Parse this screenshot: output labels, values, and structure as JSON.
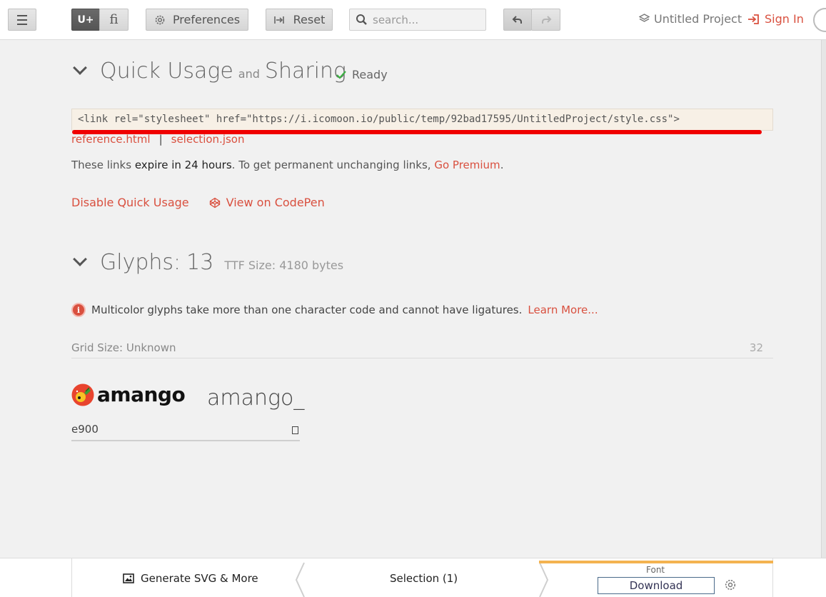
{
  "topbar": {
    "uplus_label": "U+",
    "fi_label": "fi",
    "preferences_label": "Preferences",
    "reset_label": "Reset",
    "search_placeholder": "search...",
    "project_name": "Untitled Project",
    "signin_label": "Sign In"
  },
  "quick_usage": {
    "title_part1": "Quick Usage",
    "title_and": "and",
    "title_part2": "Sharing",
    "status": "Ready",
    "code": "<link rel=\"stylesheet\" href=\"https://i.icomoon.io/public/temp/92bad17595/UntitledProject/style.css\">",
    "link_reference": "reference.html",
    "link_separator": "|",
    "link_selection": "selection.json",
    "expire_pre": "These links ",
    "expire_bold": "expire in 24 hours",
    "expire_post": ". To get permanent unchanging links, ",
    "go_premium": "Go Premium",
    "period": ".",
    "disable_label": "Disable Quick Usage",
    "codepen_label": "View on CodePen"
  },
  "glyphs": {
    "title": "Glyphs:",
    "count": "13",
    "ttf_size": "TTF Size: 4180 bytes",
    "notice_text": "Multicolor glyphs take more than one character code and cannot have ligatures.",
    "learn_more": "Learn More...",
    "grid_size": "Grid Size: Unknown",
    "grid_num": "32",
    "items": [
      {
        "logo_text": "amango",
        "name": "amango_",
        "code": "e900"
      }
    ]
  },
  "bottombar": {
    "generate_label": "Generate SVG & More",
    "selection_label": "Selection (1)",
    "font_label": "Font",
    "download_label": "Download"
  },
  "colors": {
    "accent_red": "#d9503f",
    "highlight_line": "#f00000",
    "tab_orange": "#f4b350",
    "ready_green": "#3cb043"
  }
}
